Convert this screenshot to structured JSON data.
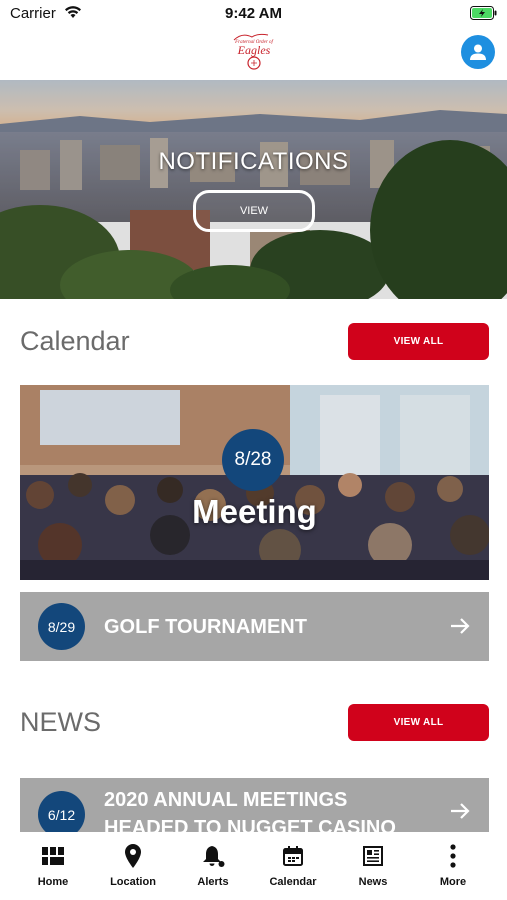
{
  "status_bar": {
    "carrier": "Carrier",
    "time": "9:42 AM"
  },
  "header": {
    "logo_text": "Eagles",
    "logo_caption": "Fraternal Order of"
  },
  "hero": {
    "title": "NOTIFICATIONS",
    "button_label": "VIEW"
  },
  "calendar": {
    "heading": "Calendar",
    "view_all_label": "VIEW ALL",
    "featured": {
      "date": "8/28",
      "title": "Meeting"
    },
    "items": [
      {
        "date": "8/29",
        "title": "GOLF TOURNAMENT"
      }
    ]
  },
  "news": {
    "heading": "NEWS",
    "view_all_label": "VIEW ALL",
    "items": [
      {
        "date": "6/12",
        "title_line1": "2020 ANNUAL MEETINGS",
        "title_line2": "HEADED TO NUGGET CASINO"
      }
    ]
  },
  "tabs": [
    {
      "label": "Home",
      "icon": "home-grid-icon"
    },
    {
      "label": "Location",
      "icon": "location-pin-icon"
    },
    {
      "label": "Alerts",
      "icon": "bell-icon"
    },
    {
      "label": "Calendar",
      "icon": "calendar-icon"
    },
    {
      "label": "News",
      "icon": "newspaper-icon"
    },
    {
      "label": "More",
      "icon": "more-vertical-icon"
    }
  ],
  "colors": {
    "accent_red": "#d0021b",
    "date_blue": "#13477b",
    "profile_blue": "#1e8fe0",
    "row_gray": "#a6a6a6"
  }
}
